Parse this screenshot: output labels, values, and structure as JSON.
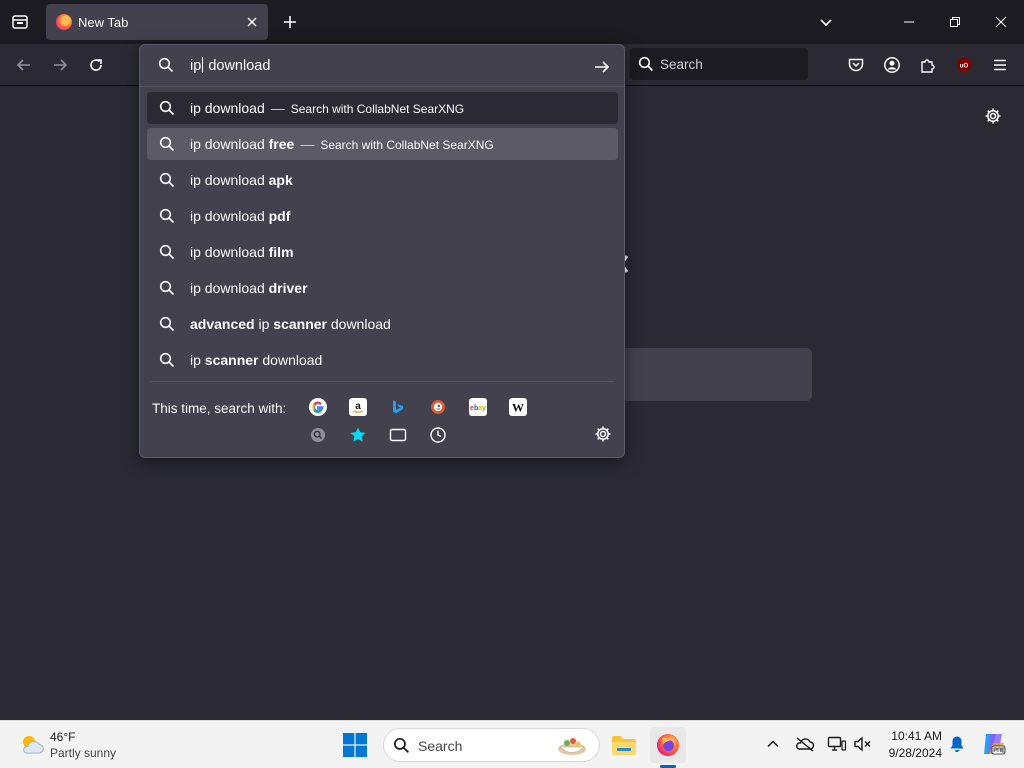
{
  "browser": {
    "tab": {
      "title": "New Tab"
    },
    "urlbar": {
      "typed_prefix": "ip",
      "typed_suffix": " download"
    },
    "searchbar": {
      "placeholder": "Search"
    }
  },
  "suggestions": [
    {
      "pre": "ip download",
      "bold": "",
      "post": "",
      "action": "Search with CollabNet SearXNG",
      "state": "dark"
    },
    {
      "pre": "ip download ",
      "bold": "free",
      "post": "",
      "action": "Search with CollabNet SearXNG",
      "state": "light"
    },
    {
      "pre": "ip download ",
      "bold": "apk",
      "post": "",
      "action": "",
      "state": ""
    },
    {
      "pre": "ip download ",
      "bold": "pdf",
      "post": "",
      "action": "",
      "state": ""
    },
    {
      "pre": "ip download ",
      "bold": "film",
      "post": "",
      "action": "",
      "state": ""
    },
    {
      "pre": "ip download ",
      "bold": "driver",
      "post": "",
      "action": "",
      "state": ""
    },
    {
      "pre": "",
      "bold": "advanced",
      "post": " ip ",
      "bold2": "scanner",
      "post2": " download",
      "action": "",
      "state": ""
    },
    {
      "pre": "ip ",
      "bold": "scanner",
      "post": " download",
      "action": "",
      "state": ""
    }
  ],
  "suggestion_separator": "—",
  "oneoff": {
    "label": "This time, search with:",
    "engines": [
      "google-icon",
      "amazon-icon",
      "bing-icon",
      "duckduckgo-icon",
      "ebay-icon",
      "wikipedia-icon"
    ],
    "modes": [
      "search-engine-icon",
      "bookmarks-star-icon",
      "tabs-icon",
      "history-icon"
    ]
  },
  "taskbar": {
    "weather": {
      "temp": "46°F",
      "desc": "Partly sunny"
    },
    "search_placeholder": "Search",
    "clock": {
      "time": "10:41 AM",
      "date": "9/28/2024"
    }
  },
  "colors": {
    "toolbar_bg": "#2b2a33",
    "tabbar_bg": "#1c1b22",
    "popup_bg": "#42414d",
    "accent": "#0067c0",
    "ublock": "#800000"
  }
}
